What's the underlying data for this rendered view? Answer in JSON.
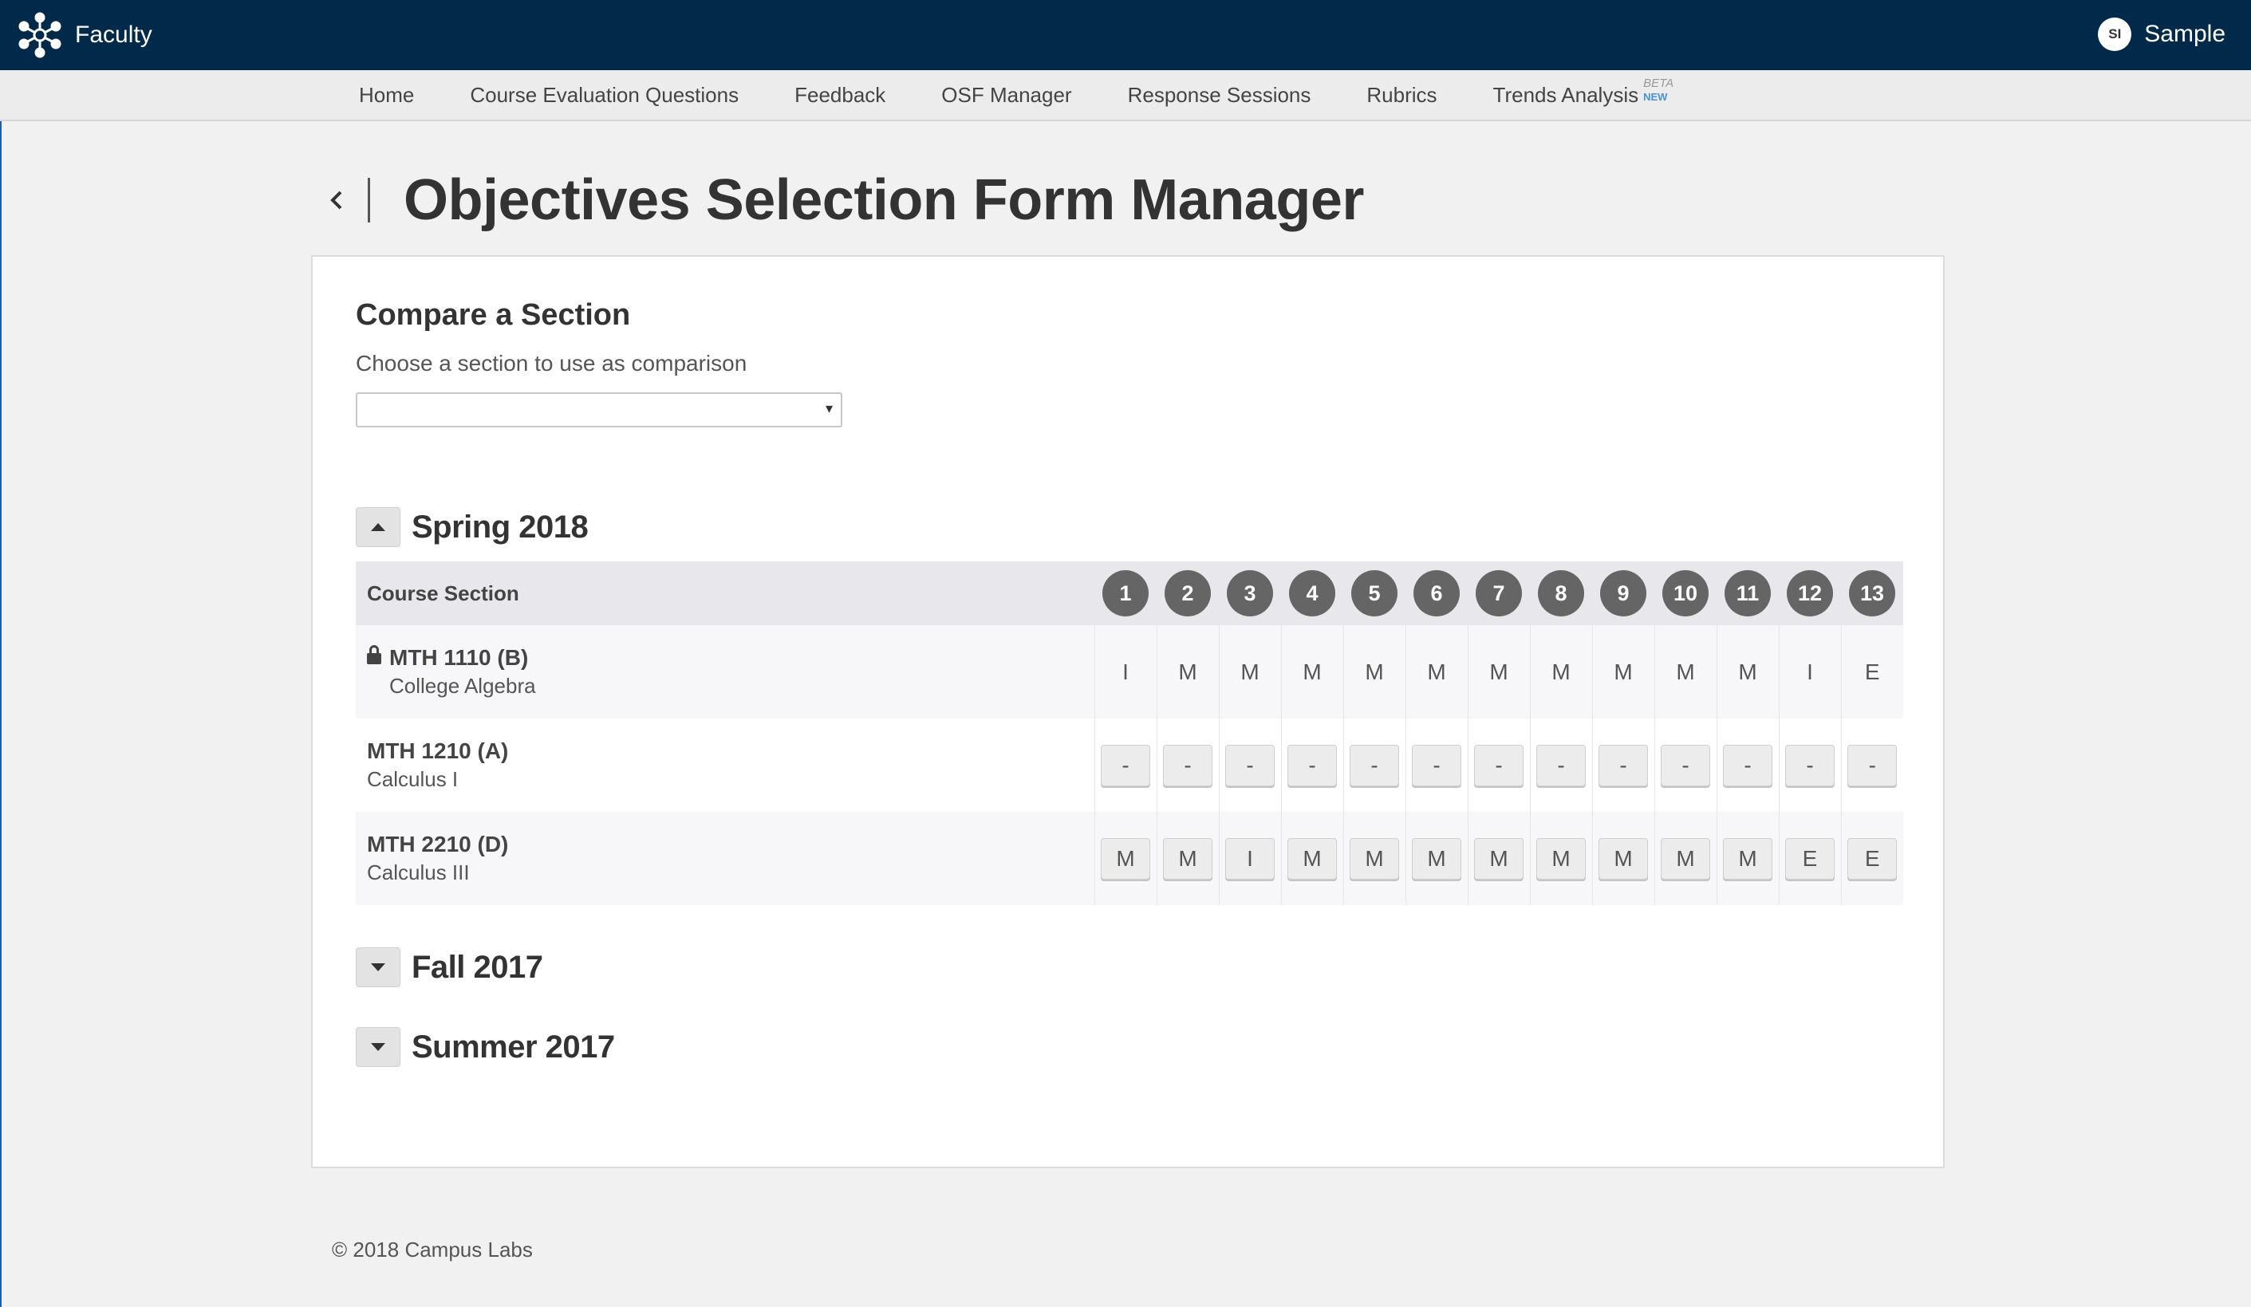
{
  "app": {
    "name": "Faculty",
    "logo_icon": "network-hub-icon"
  },
  "user": {
    "initials": "SI",
    "name": "Sample"
  },
  "nav": {
    "items": [
      {
        "label": "Home"
      },
      {
        "label": "Course Evaluation Questions"
      },
      {
        "label": "Feedback"
      },
      {
        "label": "OSF Manager"
      },
      {
        "label": "Response Sessions"
      },
      {
        "label": "Rubrics"
      },
      {
        "label": "Trends Analysis",
        "badge_top": "BETA",
        "badge_bottom": "NEW"
      }
    ]
  },
  "page": {
    "title": "Objectives Selection Form Manager",
    "back_icon": "chevron-left-icon"
  },
  "compare": {
    "title": "Compare a Section",
    "subtitle": "Choose a section to use as comparison",
    "selected": "",
    "caret": "▾"
  },
  "terms": [
    {
      "label": "Spring 2018",
      "expanded": true,
      "table": {
        "header_label": "Course Section",
        "columns": [
          "1",
          "2",
          "3",
          "4",
          "5",
          "6",
          "7",
          "8",
          "9",
          "10",
          "11",
          "12",
          "13"
        ],
        "rows": [
          {
            "code": "MTH 1110 (B)",
            "name": "College Algebra",
            "locked": true,
            "editable": false,
            "values": [
              "I",
              "M",
              "M",
              "M",
              "M",
              "M",
              "M",
              "M",
              "M",
              "M",
              "M",
              "I",
              "E"
            ]
          },
          {
            "code": "MTH 1210 (A)",
            "name": "Calculus I",
            "locked": false,
            "editable": true,
            "values": [
              "-",
              "-",
              "-",
              "-",
              "-",
              "-",
              "-",
              "-",
              "-",
              "-",
              "-",
              "-",
              "-"
            ]
          },
          {
            "code": "MTH 2210 (D)",
            "name": "Calculus III",
            "locked": false,
            "editable": true,
            "values": [
              "M",
              "M",
              "I",
              "M",
              "M",
              "M",
              "M",
              "M",
              "M",
              "M",
              "M",
              "E",
              "E"
            ]
          }
        ]
      }
    },
    {
      "label": "Fall 2017",
      "expanded": false
    },
    {
      "label": "Summer 2017",
      "expanded": false
    }
  ],
  "footer": {
    "copyright": "© 2018 Campus Labs"
  },
  "colors": {
    "topbar": "#012a4a",
    "circle": "#656565",
    "link": "#4a90d9"
  }
}
